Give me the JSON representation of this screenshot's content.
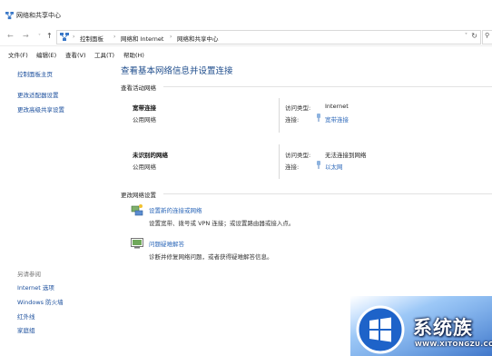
{
  "window": {
    "title": "网络和共享中心"
  },
  "address": {
    "crumbs": [
      "控制面板",
      "网络和 Internet",
      "网络和共享中心"
    ]
  },
  "menu": [
    "文件(F)",
    "编辑(E)",
    "查看(V)",
    "工具(T)",
    "帮助(H)"
  ],
  "sidebar": {
    "items": [
      "控制面板主页",
      "更改适配器设置",
      "更改高级共享设置"
    ],
    "see_also_heading": "另请参阅",
    "see_also": [
      "Internet 选项",
      "Windows 防火墙",
      "红外线",
      "家庭组"
    ]
  },
  "main": {
    "title": "查看基本网络信息并设置连接",
    "active_heading": "查看活动网络",
    "networks": [
      {
        "name": "宽带连接",
        "type": "公用网络",
        "access_label": "访问类型:",
        "access_value": "Internet",
        "conn_label": "连接:",
        "conn_value": "宽带连接"
      },
      {
        "name": "未识别的网络",
        "type": "公用网络",
        "access_label": "访问类型:",
        "access_value": "无法连接到网络",
        "conn_label": "连接:",
        "conn_value": "以太网"
      }
    ],
    "change_heading": "更改网络设置",
    "tasks": [
      {
        "link": "设置新的连接或网络",
        "desc": "设置宽带、拨号或 VPN 连接；或设置路由器或接入点。"
      },
      {
        "link": "问题疑难解答",
        "desc": "诊断并修复网络问题，或者获得疑难解答信息。"
      }
    ]
  },
  "watermark": {
    "text": "系统族",
    "url": "WWW.XITONGZU.COM"
  },
  "colors": {
    "link": "#2a66b8",
    "title": "#1f4d8c",
    "sidebar_link": "#1a4e9c"
  }
}
